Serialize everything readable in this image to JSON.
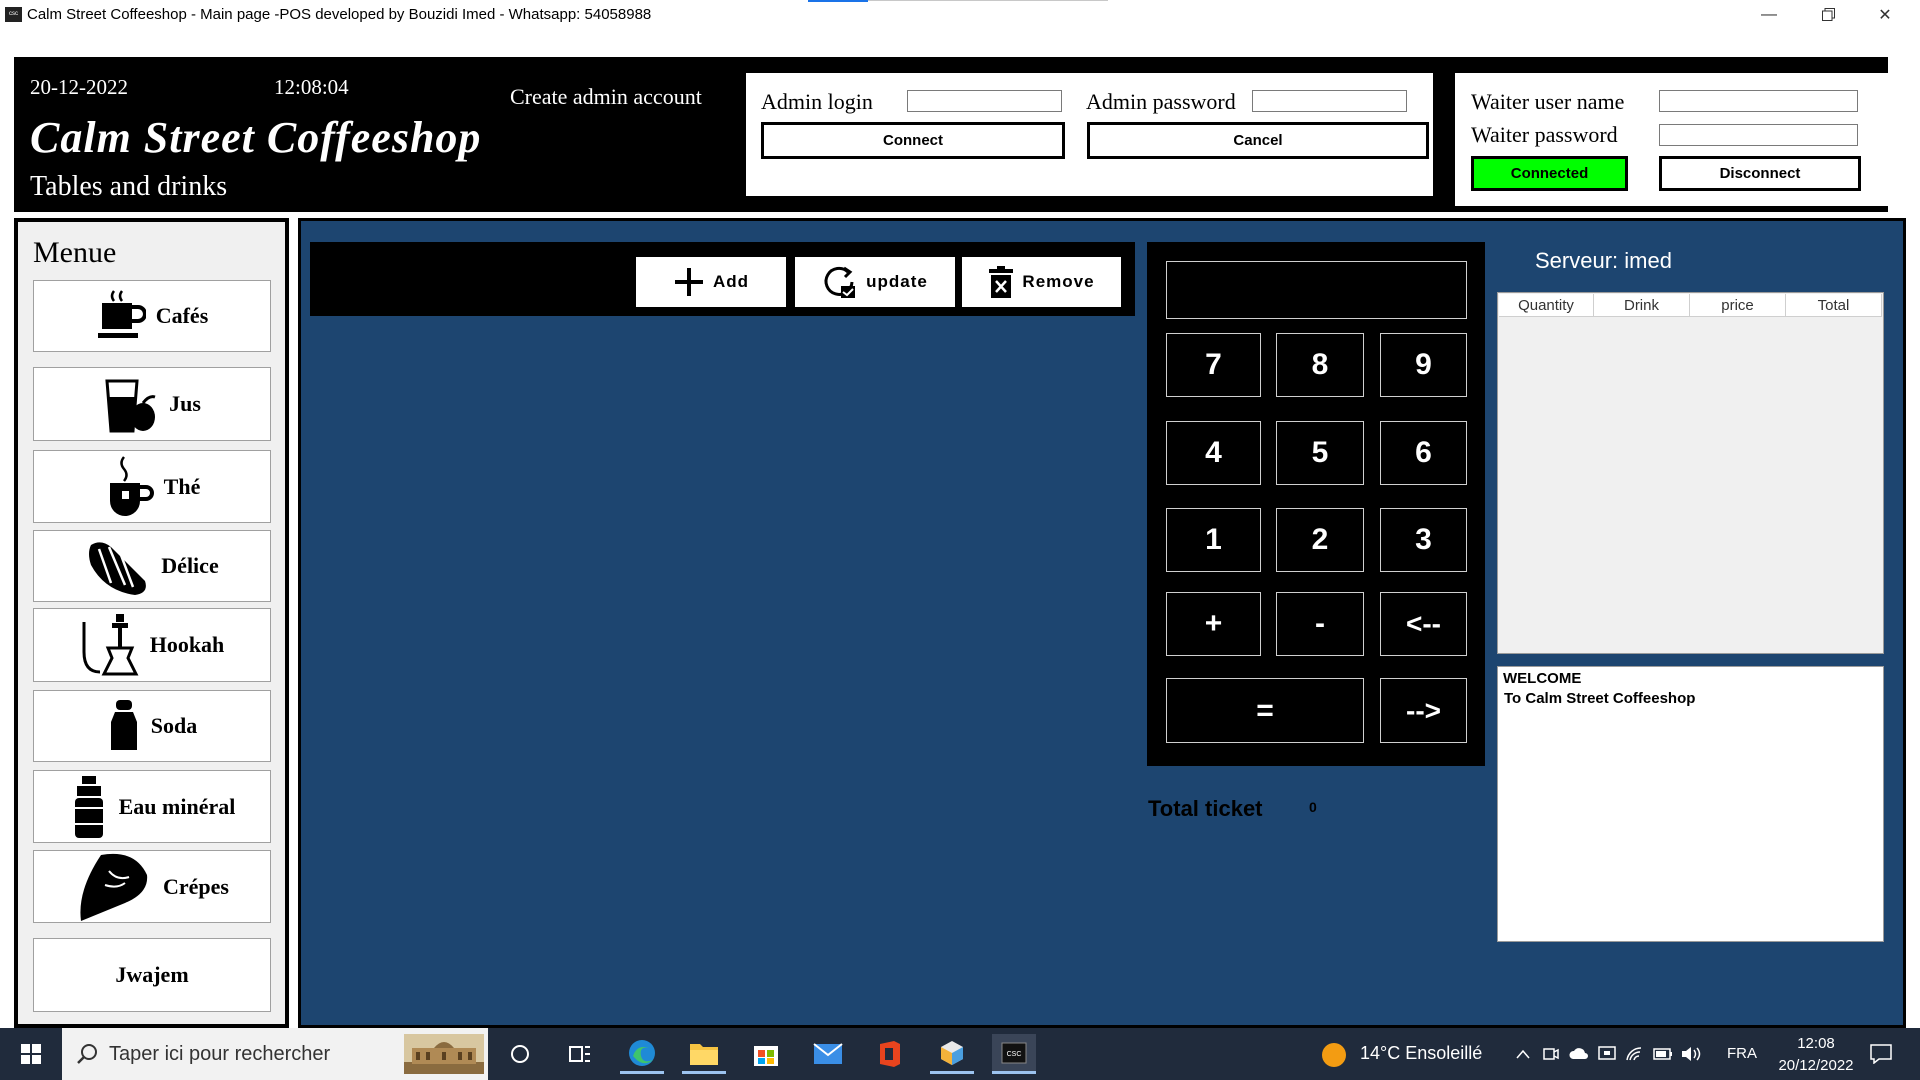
{
  "window": {
    "title": "Calm Street Coffeeshop - Main page -POS developed by Bouzidi Imed - Whatsapp: 54058988",
    "icon_text": "csc",
    "controls": [
      "minimize-icon",
      "restore-icon",
      "close-icon"
    ]
  },
  "header": {
    "date": "20-12-2022",
    "time": "12:08:04",
    "create_admin": "Create admin account",
    "shop_name": "Calm Street Coffeeshop",
    "subtitle": "Tables and drinks"
  },
  "admin": {
    "login_label": "Admin login",
    "password_label": "Admin password",
    "login_value": "",
    "password_value": "",
    "connect_label": "Connect",
    "cancel_label": "Cancel"
  },
  "waiter": {
    "username_label": "Waiter user name",
    "password_label": "Waiter password",
    "username_value": "",
    "password_value": "",
    "connected_label": "Connected",
    "disconnect_label": "Disconnect",
    "connected_color": "#00ff00"
  },
  "menu": {
    "title": "Menue",
    "items": [
      {
        "label": "Cafés",
        "icon": "coffee-cup-icon"
      },
      {
        "label": "Jus",
        "icon": "juice-glass-icon"
      },
      {
        "label": "Thé",
        "icon": "tea-cup-icon"
      },
      {
        "label": "Délice",
        "icon": "croissant-icon"
      },
      {
        "label": "Hookah",
        "icon": "hookah-icon"
      },
      {
        "label": "Soda",
        "icon": "soda-bottle-icon"
      },
      {
        "label": "Eau minéral",
        "icon": "water-bottle-icon"
      },
      {
        "label": "Crépes",
        "icon": "crepe-icon"
      },
      {
        "label": "Jwajem",
        "icon": ""
      }
    ]
  },
  "toolbar": {
    "add_label": "Add",
    "update_label": "update",
    "remove_label": "Remove"
  },
  "keypad": {
    "display_value": "",
    "keys": [
      "7",
      "8",
      "9",
      "4",
      "5",
      "6",
      "1",
      "2",
      "3",
      "+",
      "-",
      "<--",
      "=",
      "-->"
    ]
  },
  "ticket": {
    "total_label": "Total ticket",
    "total_value": "0"
  },
  "order": {
    "serveur": "Serveur: imed",
    "columns": [
      "Quantity",
      "Drink",
      "price",
      "Total"
    ],
    "rows": []
  },
  "messages": {
    "line1": "WELCOME",
    "line2": "To Calm Street Coffeeshop"
  },
  "taskbar": {
    "search_placeholder": "Taper ici pour rechercher",
    "weather": "14°C  Ensoleillé",
    "language": "FRA",
    "clock_time": "12:08",
    "clock_date": "20/12/2022"
  },
  "colors": {
    "main_bg": "#1d4570",
    "header_bg": "#000000",
    "taskbar_bg": "#202b3c"
  }
}
